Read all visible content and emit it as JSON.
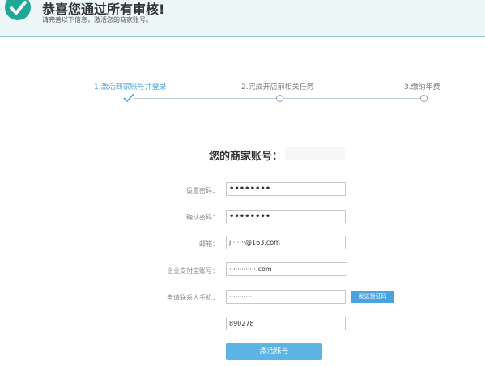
{
  "banner": {
    "title": "恭喜您通过所有审核!",
    "subtitle": "请完善以下信息，激活您的商家账号。"
  },
  "steps": [
    {
      "label": "1.激活商家账号并登录",
      "state": "done"
    },
    {
      "label": "2.完成开店前相关任务",
      "state": "pending"
    },
    {
      "label": "3.缴纳年费",
      "state": "pending"
    }
  ],
  "account": {
    "heading": "您的商家账号："
  },
  "form": {
    "password_label": "设置密码：",
    "password_value": "••••••••",
    "confirm_label": "确认密码：",
    "confirm_value": "••••••••",
    "email_label": "邮箱：",
    "email_value": "j·······@163.com",
    "alipay_label": "企业支付宝账号：",
    "alipay_value": "·············.com",
    "phone_label": "申请联系人手机：",
    "phone_value": "···········",
    "send_code_label": "发送验证码",
    "code_value": "890278",
    "submit_label": "激活账号"
  },
  "colors": {
    "accent": "#4aa3df",
    "success": "#1ea896",
    "banner_bg": "#eef7f7"
  }
}
